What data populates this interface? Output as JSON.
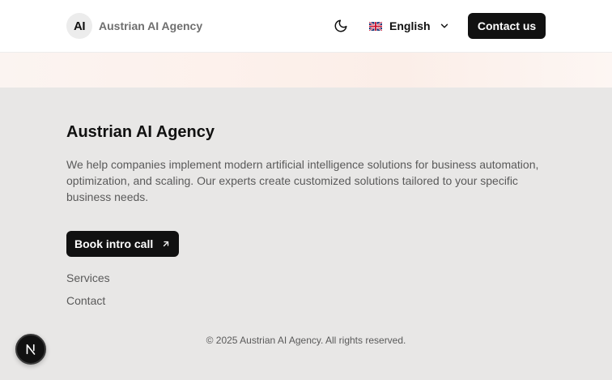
{
  "header": {
    "logo_badge": "AI",
    "logo_text": "Austrian AI Agency",
    "theme_icon": "moon-icon",
    "language": {
      "label": "English",
      "flag_icon": "uk-flag-icon",
      "chevron_icon": "chevron-down-icon"
    },
    "contact_label": "Contact us"
  },
  "footer": {
    "title": "Austrian AI Agency",
    "description": "We help companies implement modern artificial intelligence solutions for business automation, optimization, and scaling. Our experts create customized solutions tailored to your specific business needs.",
    "book_label": "Book intro call",
    "book_icon": "arrow-up-right-icon",
    "links": [
      "Services",
      "Contact"
    ],
    "copyright": "© 2025 Austrian AI Agency. All rights reserved."
  },
  "dev_badge": {
    "label": "N",
    "icon": "nextjs-icon"
  },
  "colors": {
    "header_bg": "#ffffff",
    "footer_bg": "#e8e7e6",
    "button_bg": "#111111",
    "button_text": "#ffffff",
    "muted_text": "#5a5a5a"
  }
}
